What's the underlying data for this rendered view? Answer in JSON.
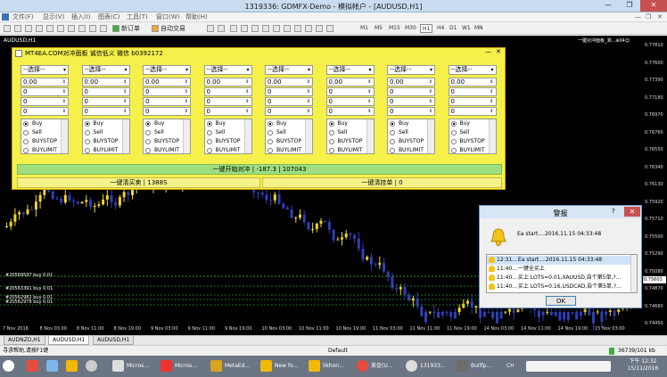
{
  "window": {
    "title": "1319336: GDMFX-Demo - 模拟帐户 - [AUDUSD,H1]",
    "min": "—",
    "max": "❐",
    "close": "✕"
  },
  "menu": {
    "items": [
      "文件(F)",
      "显示(V)",
      "插入(I)",
      "图表(C)",
      "工具(T)",
      "窗口(W)",
      "帮助(H)"
    ],
    "right_min": "—",
    "right_restore": "❐",
    "right_close": "✕"
  },
  "toolbar": {
    "new_order": "新订单",
    "auto_trading": "自动交易",
    "timeframes": [
      "M1",
      "M5",
      "M15",
      "M30",
      "H1",
      "H4",
      "D1",
      "W1",
      "MN"
    ]
  },
  "chart": {
    "title": "AUDUSD,H1",
    "note": "一键对冲面板_测...⊕04☺",
    "price_label": "0.75603",
    "y_ticks": [
      "0.77810",
      "0.77600",
      "0.77390",
      "0.77180",
      "0.76970",
      "0.76760",
      "0.76550",
      "0.76340",
      "0.76130",
      "0.75920",
      "0.75710",
      "0.75500",
      "0.75290",
      "0.75080",
      "0.74870",
      "0.74660",
      "0.74450"
    ],
    "x_ticks": [
      "7 Nov 2016",
      "8 Nov 03:00",
      "8 Nov 11:00",
      "8 Nov 19:00",
      "9 Nov 03:00",
      "9 Nov 11:00",
      "9 Nov 19:00",
      "10 Nov 03:00",
      "10 Nov 11:00",
      "10 Nov 19:00",
      "11 Nov 03:00",
      "11 Nov 11:00",
      "11 Nov 19:00",
      "14 Nov 03:00",
      "14 Nov 11:00",
      "14 Nov 19:00",
      "15 Nov 03:00"
    ],
    "orders": [
      "#20569597 buy 0.01",
      "#20563391 buy 0.01",
      "#20562982 buy 0.01",
      "#20562978 buy 0.01"
    ]
  },
  "panel": {
    "header": "MT4EA.COM对冲面板 诚信低义 微信 b0392172",
    "columns": [
      {
        "select": "--选择--",
        "v1": "0.00",
        "v2": "0",
        "v3": "0",
        "v4": "0"
      },
      {
        "select": "--选择--",
        "v1": "0.00",
        "v2": "0",
        "v3": "0",
        "v4": "0"
      },
      {
        "select": "--选择--",
        "v1": "0.00",
        "v2": "0",
        "v3": "0",
        "v4": "0"
      },
      {
        "select": "--选择--",
        "v1": "0.00",
        "v2": "0",
        "v3": "0",
        "v4": "0"
      },
      {
        "select": "--选择--",
        "v1": "0.00",
        "v2": "0",
        "v3": "0",
        "v4": "0"
      },
      {
        "select": "--选择--",
        "v1": "0.00",
        "v2": "0",
        "v3": "0",
        "v4": "0"
      },
      {
        "select": "--选择--",
        "v1": "0.00",
        "v2": "0",
        "v3": "0",
        "v4": "0"
      },
      {
        "select": "--选择--",
        "v1": "0.00",
        "v2": "0",
        "v3": "0",
        "v4": "0"
      }
    ],
    "options": [
      "Buy",
      "Sell",
      "BUYSTOP",
      "BUYLIMIT"
    ],
    "big_button": "一键开始对冲 | -187.3 | 107043",
    "close_button": "一键清买卖 | 1388S",
    "pending_button": "一键清挂单 | 0"
  },
  "alert": {
    "title": "警报",
    "help": "?",
    "close": "✕",
    "message": "Ea start....2016.11.15 04:33:48",
    "rows": [
      {
        "time": "12:31...",
        "text": "Ea start....2016.11.15 04:33:48"
      },
      {
        "time": "11:40...",
        "text": "一键全买上"
      },
      {
        "time": "11:40...",
        "text": "买上 LOTS=0.01,XAUUSD,自个第5单,?..."
      },
      {
        "time": "11:40...",
        "text": "买上 LOTS=0.16,USDCAD,自个第5单,?..."
      }
    ],
    "ok": "OK"
  },
  "tabs": [
    "AUDNZD,H1",
    "AUDUSD,H1",
    "AUDUSD,H1"
  ],
  "status": {
    "help": "寻求帮助,请按F1键",
    "profile": "Default",
    "conn": "36739/101 kb"
  },
  "taskbar": {
    "items": [
      "Micros...",
      "Micros...",
      "MetaEd...",
      "New fo...",
      "likhon...",
      "美金(U...",
      "131933...",
      "Bullfp..."
    ],
    "time": "下午 12:32",
    "date": "15/11/2016"
  },
  "colors": {
    "panel": "#f5f04a",
    "green": "#9fde7f",
    "bull": "#f2d32b",
    "bear": "#2f3fb8"
  }
}
